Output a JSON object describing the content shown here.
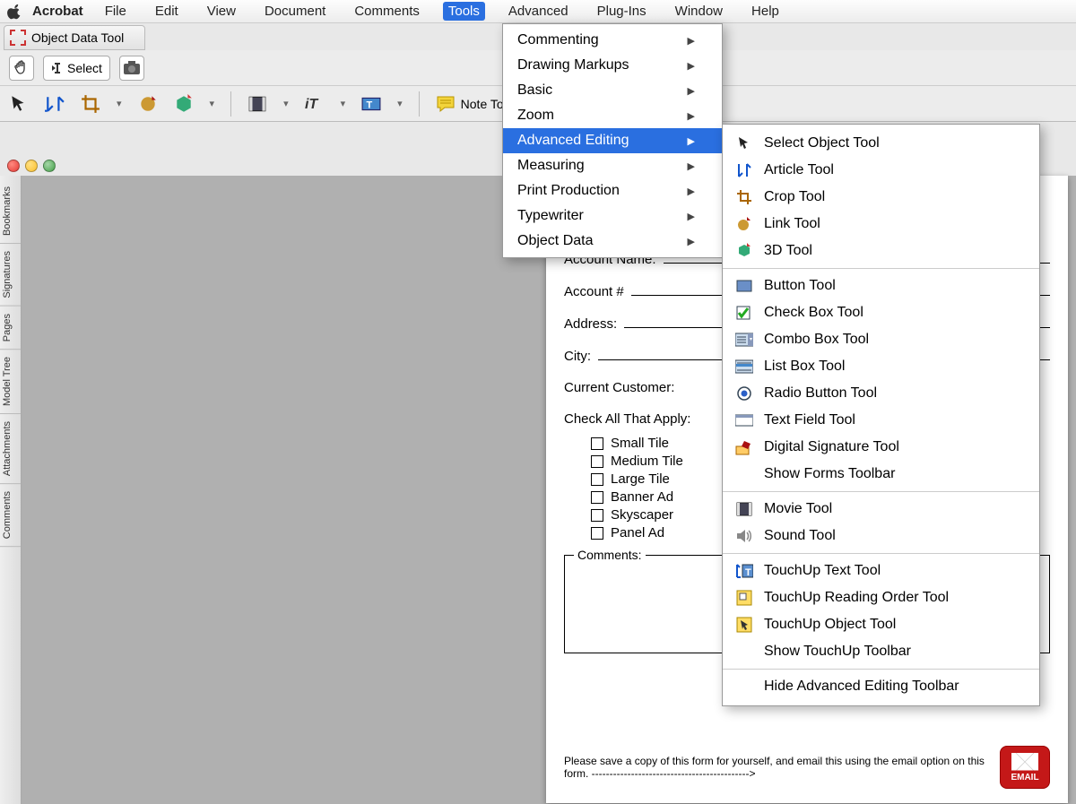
{
  "menubar": {
    "app": "Acrobat",
    "items": [
      "File",
      "Edit",
      "View",
      "Document",
      "Comments",
      "Tools",
      "Advanced",
      "Plug-Ins",
      "Window",
      "Help"
    ],
    "selected": "Tools"
  },
  "titlebar": "Object Data Tool",
  "toolbar1": {
    "select": "Select"
  },
  "toolbar2": {
    "note": "Note Tool"
  },
  "sidebar_tabs": [
    "Bookmarks",
    "Signatures",
    "Pages",
    "Model Tree",
    "Attachments",
    "Comments"
  ],
  "tools_menu": {
    "items": [
      "Commenting",
      "Drawing Markups",
      "Basic",
      "Zoom",
      "Advanced Editing",
      "Measuring",
      "Print Production",
      "Typewriter",
      "Object Data"
    ],
    "selected": "Advanced Editing"
  },
  "advanced_editing_submenu": [
    {
      "label": "Select Object Tool",
      "icon": "pointer"
    },
    {
      "label": "Article Tool",
      "icon": "article"
    },
    {
      "label": "Crop Tool",
      "icon": "crop"
    },
    {
      "label": "Link Tool",
      "icon": "link"
    },
    {
      "label": "3D Tool",
      "icon": "3d"
    },
    {
      "div": true
    },
    {
      "label": "Button Tool",
      "icon": "button"
    },
    {
      "label": "Check Box Tool",
      "icon": "checkbox"
    },
    {
      "label": "Combo Box Tool",
      "icon": "combo"
    },
    {
      "label": "List Box Tool",
      "icon": "listbox"
    },
    {
      "label": "Radio Button Tool",
      "icon": "radio"
    },
    {
      "label": "Text Field Tool",
      "icon": "textfield"
    },
    {
      "label": "Digital Signature Tool",
      "icon": "signature"
    },
    {
      "label": "Show Forms Toolbar",
      "icon": ""
    },
    {
      "div": true
    },
    {
      "label": "Movie Tool",
      "icon": "movie"
    },
    {
      "label": "Sound Tool",
      "icon": "sound"
    },
    {
      "div": true
    },
    {
      "label": "TouchUp Text Tool",
      "icon": "touchtext"
    },
    {
      "label": "TouchUp Reading Order Tool",
      "icon": "touchorder"
    },
    {
      "label": "TouchUp Object Tool",
      "icon": "touchobj"
    },
    {
      "label": "Show TouchUp Toolbar",
      "icon": ""
    },
    {
      "div": true
    },
    {
      "label": "Hide Advanced Editing Toolbar",
      "icon": ""
    }
  ],
  "form": {
    "account_name": "Account Name:",
    "account_num": "Account #",
    "address": "Address:",
    "city": "City:",
    "current_customer": "Current Customer:",
    "check_all": "Check All That Apply:",
    "options": [
      "Small Tile",
      "Medium Tile",
      "Large Tile",
      "Banner Ad",
      "Skyscaper",
      "Panel Ad"
    ],
    "comments": "Comments:",
    "footer": "Please save a copy of this form for yourself, and email this using the email option on this form. -------------------------------------------->",
    "email_btn": "EMAIL"
  }
}
